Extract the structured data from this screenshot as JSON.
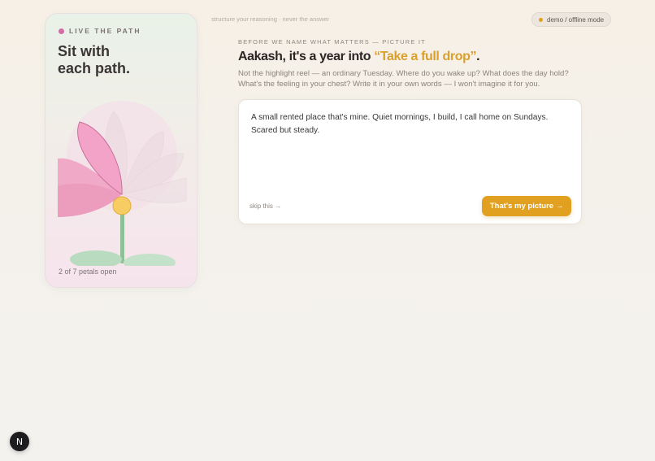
{
  "sidebar": {
    "eyebrow": "LIVE THE PATH",
    "title_line1": "Sit with",
    "title_line2": "each path.",
    "petals_status": "2 of 7 petals open",
    "accent_color": "#d16ea6"
  },
  "topbar": {
    "note": "structure your reasoning · never the answer",
    "mode_badge": "demo / offline mode",
    "mode_dot_color": "#e0a21c"
  },
  "main": {
    "kicker": "BEFORE WE NAME WHAT MATTERS — PICTURE IT",
    "headline_prefix": "Aakash, it's a year into ",
    "headline_accent": "“Take a full drop”",
    "headline_suffix": ".",
    "lede": "Not the highlight reel — an ordinary Tuesday. Where do you wake up? What does the day hold? What's the feeling in your chest? Write it in your own words — I won't imagine it for you.",
    "answer": "A small rented place that's mine. Quiet mornings, I build, I call home on Sundays. Scared but steady.",
    "skip_label": "skip this →",
    "confirm_label": "That's my picture →",
    "accent_color": "#e1a01f"
  },
  "app_badge": {
    "letter": "N"
  }
}
